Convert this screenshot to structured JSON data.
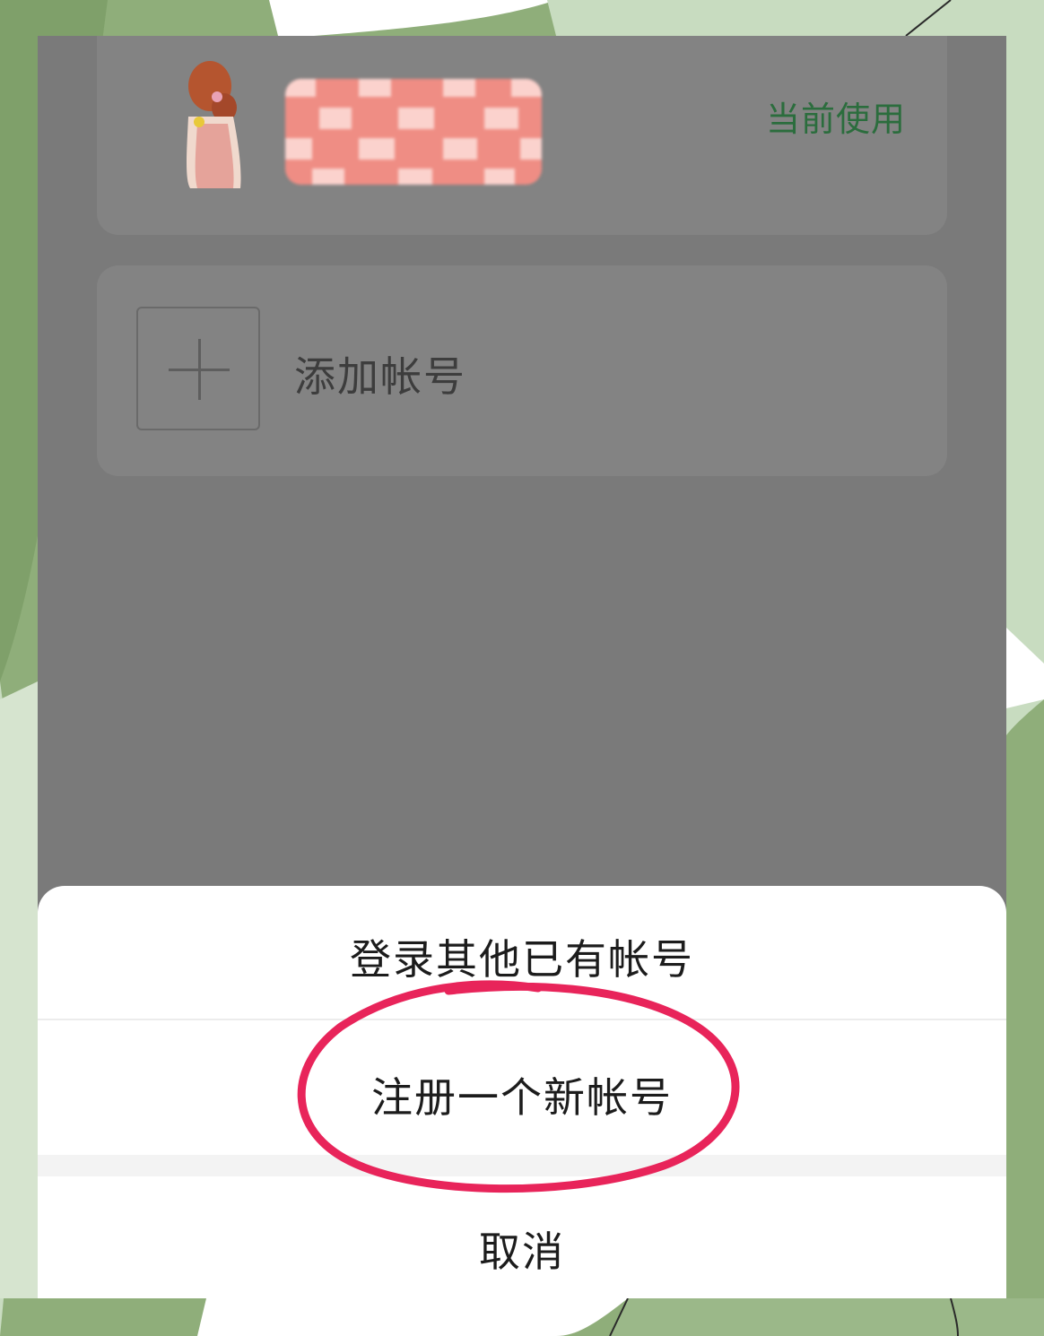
{
  "account_list": {
    "current_account": {
      "status_label": "当前使用",
      "colors": {
        "status": "#2b6d3d"
      }
    },
    "add_account": {
      "label": "添加帐号"
    }
  },
  "action_sheet": {
    "login_existing_label": "登录其他已有帐号",
    "register_new_label": "注册一个新帐号",
    "cancel_label": "取消"
  },
  "annotation": {
    "circle_color": "#e8245a"
  },
  "icons": [
    "avatar-image",
    "plus-icon"
  ]
}
